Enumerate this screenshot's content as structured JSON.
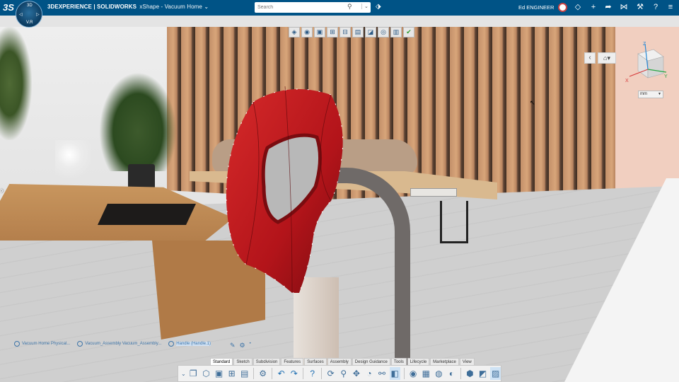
{
  "topbar": {
    "brand_strong": "3DEXPERIENCE | SOLIDWORKS",
    "app_name": "xShape - Vacuum Home",
    "search_placeholder": "Search",
    "user_name": "Ed ENGINEER",
    "icons": [
      "compass-icon",
      "search-icon",
      "tag-icon",
      "share-icon",
      "plus-icon",
      "forward-icon",
      "network-icon",
      "tools-icon",
      "help-icon",
      "menu-icon"
    ]
  },
  "compass": {
    "north": "3D",
    "east": "▷",
    "west": "◁",
    "south": "V.R"
  },
  "viewport": {
    "unit": "mm",
    "view_toolbar_count": 10
  },
  "breadcrumb": [
    {
      "label": "Vacuum Home Physical..."
    },
    {
      "label": "Vacuum_Assembly Vacuum_Assembly..."
    },
    {
      "label": "Handle (Handle.1)"
    }
  ],
  "action_tabs": [
    {
      "label": "Standard",
      "active": true
    },
    {
      "label": "Sketch",
      "active": false
    },
    {
      "label": "Subdivision",
      "active": false
    },
    {
      "label": "Features",
      "active": false
    },
    {
      "label": "Surfaces",
      "active": false
    },
    {
      "label": "Assembly",
      "active": false
    },
    {
      "label": "Design Guidance",
      "active": false
    },
    {
      "label": "Tools",
      "active": false
    },
    {
      "label": "Lifecycle",
      "active": false
    },
    {
      "label": "Marketplace",
      "active": false
    },
    {
      "label": "View",
      "active": false
    }
  ],
  "colors": {
    "topbar": "#005386",
    "accent": "#3d74a8",
    "handle": "#b3141a"
  }
}
